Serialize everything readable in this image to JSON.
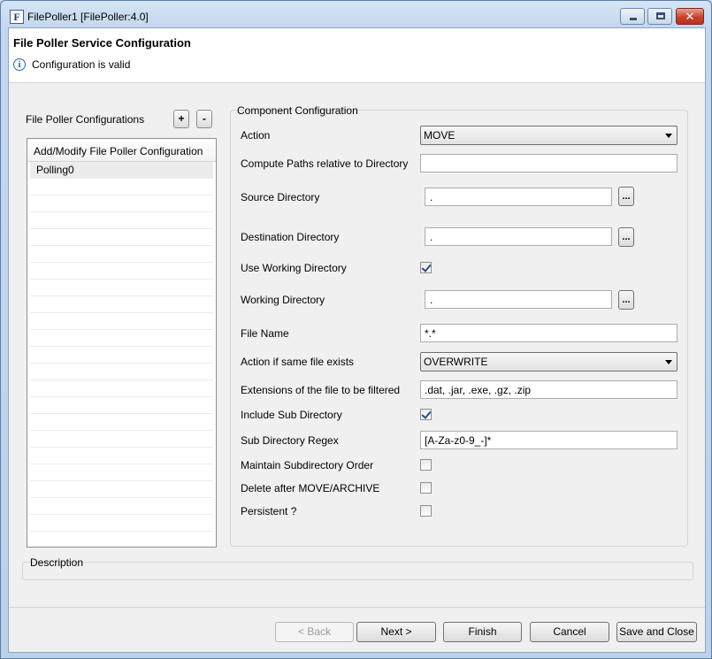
{
  "window": {
    "title": "FilePoller1 [FilePoller:4.0]",
    "app_icon": "F",
    "close_glyph": "✕"
  },
  "header": {
    "title": "File Poller Service Configuration",
    "status_icon": "i",
    "status": "Configuration is valid"
  },
  "left_panel": {
    "title": "File Poller Configurations",
    "add_label": "+",
    "remove_label": "-",
    "column_header": "Add/Modify File Poller Configuration",
    "rows": [
      "Polling0"
    ]
  },
  "component": {
    "group_label": "Component Configuration",
    "action": {
      "label": "Action",
      "value": "MOVE"
    },
    "compute_paths": {
      "label": "Compute Paths relative to Directory",
      "value": ""
    },
    "source_dir": {
      "label": "Source Directory",
      "value": ".",
      "browse": "..."
    },
    "dest_dir": {
      "label": "Destination Directory",
      "value": ".",
      "browse": "..."
    },
    "use_working_dir": {
      "label": "Use Working Directory",
      "checked": true
    },
    "working_dir": {
      "label": "Working Directory",
      "value": ".",
      "browse": "..."
    },
    "file_name": {
      "label": "File Name",
      "value": "*.*"
    },
    "same_file_action": {
      "label": "Action if same file exists",
      "value": "OVERWRITE"
    },
    "extensions": {
      "label": "Extensions of the file to be filtered",
      "value": ".dat, .jar, .exe, .gz, .zip"
    },
    "include_sub_dir": {
      "label": "Include Sub Directory",
      "checked": true
    },
    "sub_dir_regex": {
      "label": "Sub Directory Regex",
      "value": "[A-Za-z0-9_-]*"
    },
    "maintain_order": {
      "label": "Maintain Subdirectory Order",
      "checked": false
    },
    "delete_after": {
      "label": "Delete after MOVE/ARCHIVE",
      "checked": false
    },
    "persistent": {
      "label": "Persistent ?",
      "checked": false
    }
  },
  "description": {
    "label": "Description"
  },
  "buttons": {
    "back": "< Back",
    "next": "Next >",
    "finish": "Finish",
    "cancel": "Cancel",
    "save_close": "Save and Close"
  }
}
